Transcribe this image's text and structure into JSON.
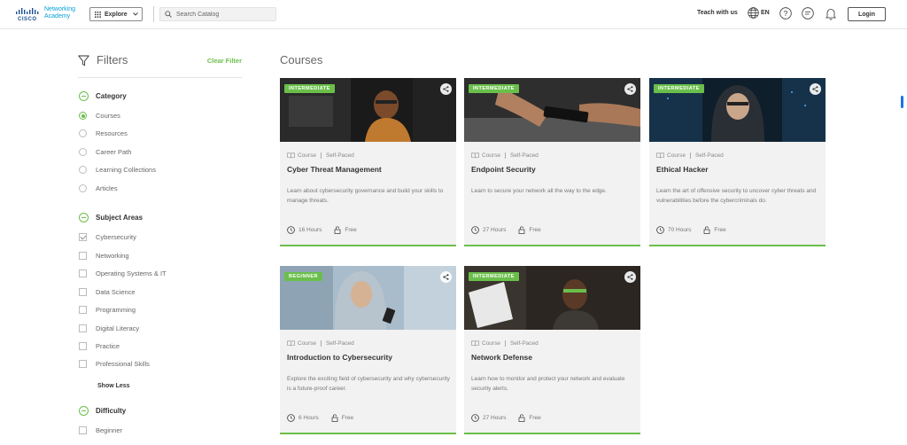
{
  "header": {
    "brand_top": "Networking",
    "brand_bottom": "Academy",
    "brand_cisco": "CISCO",
    "explore_label": "Explore",
    "search_placeholder": "Search Catalog",
    "teach_label": "Teach with us",
    "language": "EN",
    "login_label": "Login"
  },
  "sidebar": {
    "title": "Filters",
    "clear_label": "Clear Filter",
    "category": {
      "heading": "Category",
      "options": [
        {
          "label": "Courses",
          "selected": true
        },
        {
          "label": "Resources",
          "selected": false
        },
        {
          "label": "Career Path",
          "selected": false
        },
        {
          "label": "Learning Collections",
          "selected": false
        },
        {
          "label": "Articles",
          "selected": false
        }
      ]
    },
    "subject_areas": {
      "heading": "Subject Areas",
      "options": [
        {
          "label": "Cybersecurity",
          "checked": true
        },
        {
          "label": "Networking",
          "checked": false
        },
        {
          "label": "Operating Systems & IT",
          "checked": false
        },
        {
          "label": "Data Science",
          "checked": false
        },
        {
          "label": "Programming",
          "checked": false
        },
        {
          "label": "Digital Literacy",
          "checked": false
        },
        {
          "label": "Practice",
          "checked": false
        },
        {
          "label": "Professional Skills",
          "checked": false
        }
      ],
      "show_less_label": "Show Less"
    },
    "difficulty": {
      "heading": "Difficulty",
      "options": [
        {
          "label": "Beginner",
          "checked": false
        }
      ]
    }
  },
  "main": {
    "title": "Courses",
    "cards": [
      {
        "level": "INTERMEDIATE",
        "type": "Course",
        "pace": "Self-Paced",
        "title": "Cyber Threat Management",
        "description": "Learn about cybersecurity governance and build your skills to manage threats.",
        "duration": "16 Hours",
        "price": "Free"
      },
      {
        "level": "INTERMEDIATE",
        "type": "Course",
        "pace": "Self-Paced",
        "title": "Endpoint Security",
        "description": "Learn to secure your network all the way to the edge.",
        "duration": "27 Hours",
        "price": "Free"
      },
      {
        "level": "INTERMEDIATE",
        "type": "Course",
        "pace": "Self-Paced",
        "title": "Ethical Hacker",
        "description": "Learn the art of offensive security to uncover cyber threats and vulnerabilities before the cybercriminals do.",
        "duration": "70 Hours",
        "price": "Free"
      },
      {
        "level": "BEGINNER",
        "type": "Course",
        "pace": "Self-Paced",
        "title": "Introduction to Cybersecurity",
        "description": "Explore the exciting field of cybersecurity and why cybersecurity is a future-proof career.",
        "duration": "6 Hours",
        "price": "Free"
      },
      {
        "level": "INTERMEDIATE",
        "type": "Course",
        "pace": "Self-Paced",
        "title": "Network Defense",
        "description": "Learn how to monitor and protect your network and evaluate security alerts.",
        "duration": "27 Hours",
        "price": "Free"
      }
    ]
  },
  "colors": {
    "accent_green": "#6abf4b",
    "card_bg": "#f2f2f2",
    "brand_blue": "#049fd9"
  }
}
